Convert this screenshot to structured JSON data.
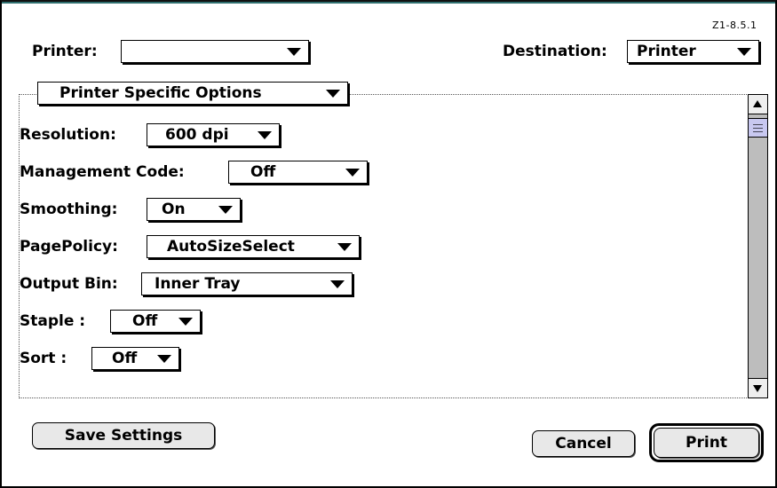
{
  "version": "Z1-8.5.1",
  "printer": {
    "label": "Printer:",
    "value": ""
  },
  "destination": {
    "label": "Destination:",
    "value": "Printer"
  },
  "section_menu": {
    "value": "Printer Specific Options"
  },
  "options": [
    {
      "label": "Resolution:",
      "value": "600 dpi"
    },
    {
      "label": "Management Code:",
      "value": "Off"
    },
    {
      "label": "Smoothing:",
      "value": "On"
    },
    {
      "label": "PagePolicy:",
      "value": "AutoSizeSelect"
    },
    {
      "label": "Output Bin:",
      "value": "Inner Tray"
    },
    {
      "label": "Staple :",
      "value": "Off"
    },
    {
      "label": "Sort :",
      "value": "Off"
    }
  ],
  "buttons": {
    "save": "Save Settings",
    "cancel": "Cancel",
    "print": "Print"
  },
  "colors": {
    "title_bar_accent": "#2f6f6f",
    "scroll_track": "#bdbdbd",
    "scroll_thumb": "#c8c8f0"
  }
}
